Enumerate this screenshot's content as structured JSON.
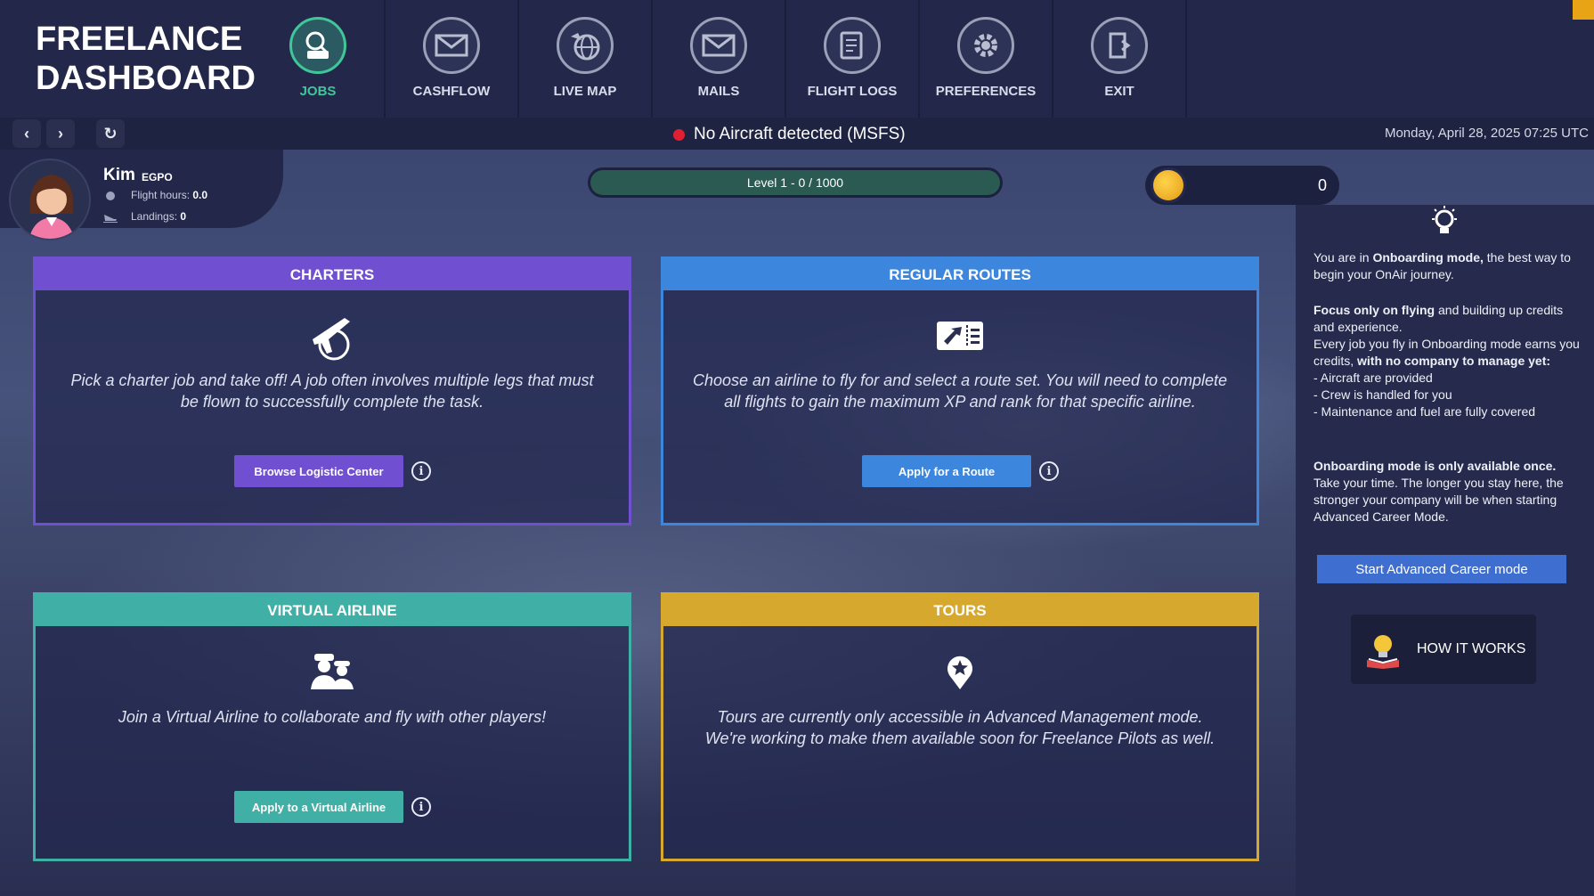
{
  "app": {
    "title_line1": "FREELANCE",
    "title_line2": "DASHBOARD"
  },
  "nav": {
    "items": [
      {
        "label": "JOBS",
        "icon": "jobs-icon",
        "active": true
      },
      {
        "label": "CASHFLOW",
        "icon": "cashflow-icon",
        "active": false
      },
      {
        "label": "LIVE MAP",
        "icon": "live-map-icon",
        "active": false
      },
      {
        "label": "MAILS",
        "icon": "mail-icon",
        "active": false
      },
      {
        "label": "FLIGHT LOGS",
        "icon": "flight-logs-icon",
        "active": false
      },
      {
        "label": "PREFERENCES",
        "icon": "gear-icon",
        "active": false
      },
      {
        "label": "EXIT",
        "icon": "exit-icon",
        "active": false
      }
    ]
  },
  "toolbar": {
    "back_icon": "chevron-left-icon",
    "forward_icon": "chevron-right-icon",
    "refresh_icon": "refresh-icon",
    "status_text": "No Aircraft detected (MSFS)",
    "status_color": "#e02030",
    "datetime": "Monday, April 28, 2025 07:25 UTC"
  },
  "profile": {
    "name": "Kim",
    "code": "EGPO",
    "flight_hours_label": "Flight hours:",
    "flight_hours_value": "0.0",
    "landings_label": "Landings:",
    "landings_value": "0"
  },
  "level": {
    "text": "Level 1 - 0 / 1000",
    "progress_fraction": 0
  },
  "credits": {
    "value": "0"
  },
  "cards": {
    "charters": {
      "title": "CHARTERS",
      "description": "Pick a charter job and take off! A job often involves multiple legs that must be flown to successfully complete the task.",
      "button": "Browse Logistic Center",
      "color": "#7050d0"
    },
    "routes": {
      "title": "REGULAR ROUTES",
      "description": "Choose an airline to fly for and select a route set. You will need to complete all flights to gain the maximum XP and rank for that specific airline.",
      "button": "Apply for a Route",
      "color": "#3c86de"
    },
    "virtual_airline": {
      "title": "VIRTUAL AIRLINE",
      "description": "Join a Virtual Airline to collaborate and fly with other players!",
      "button": "Apply to a Virtual Airline",
      "color": "#40b0a6"
    },
    "tours": {
      "title": "TOURS",
      "description_line1": "Tours are currently only accessible in Advanced Management mode.",
      "description_line2": "We're working to make them available soon for Freelance Pilots as well.",
      "color": "#d6a82e"
    }
  },
  "onboarding": {
    "p1_a": "You are in ",
    "p1_b": "Onboarding mode,",
    "p1_c": " the best way to begin your OnAir journey.",
    "p2_a": "Focus only on flying",
    "p2_b": " and building up credits and experience.",
    "p3_a": "Every job you fly in Onboarding mode earns you credits, ",
    "p3_b": "with no company to manage yet:",
    "bullet1": "- Aircraft are provided",
    "bullet2": "- Crew is handled for you",
    "bullet3": "- Maintenance and fuel are fully covered",
    "p4_a": "Onboarding mode is only available once.",
    "p4_b": " Take your time. The longer you stay here, the stronger your company will be when starting Advanced Career Mode.",
    "button": "Start Advanced Career mode",
    "how_it_works": "HOW IT WORKS"
  }
}
